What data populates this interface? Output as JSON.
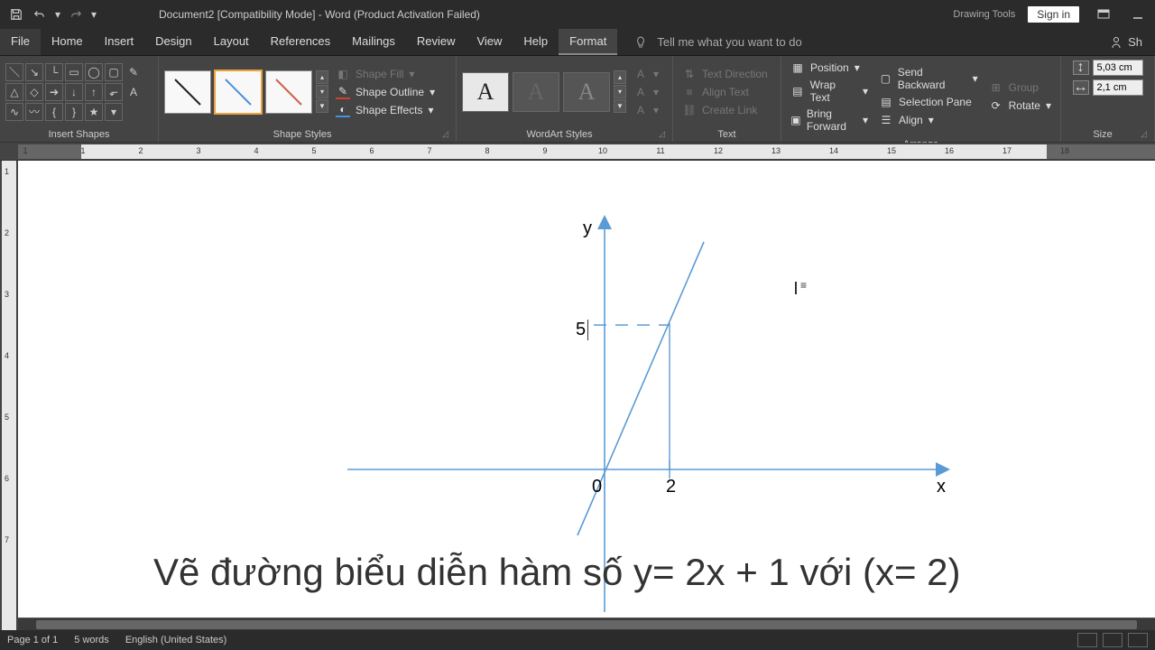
{
  "titlebar": {
    "document_title": "Document2 [Compatibility Mode] - Word (Product Activation Failed)",
    "context_tools": "Drawing Tools",
    "signin": "Sign in"
  },
  "menu": {
    "file": "File",
    "home": "Home",
    "insert": "Insert",
    "design": "Design",
    "layout": "Layout",
    "references": "References",
    "mailings": "Mailings",
    "review": "Review",
    "view": "View",
    "help": "Help",
    "format": "Format",
    "tellme": "Tell me what you want to do",
    "share": "Sh"
  },
  "ribbon": {
    "insert_shapes": "Insert Shapes",
    "shape_styles": "Shape Styles",
    "wordart_styles": "WordArt Styles",
    "text": "Text",
    "arrange": "Arrange",
    "size": "Size",
    "shape_fill": "Shape Fill",
    "shape_outline": "Shape Outline",
    "shape_effects": "Shape Effects",
    "text_direction": "Text Direction",
    "align_text": "Align Text",
    "create_link": "Create Link",
    "position": "Position",
    "wrap_text": "Wrap Text",
    "bring_forward": "Bring Forward",
    "send_backward": "Send Backward",
    "selection_pane": "Selection Pane",
    "align": "Align",
    "group": "Group",
    "rotate": "Rotate",
    "height": "5,03 cm",
    "width": "2,1 cm",
    "wa_sample": "A"
  },
  "ruler": {
    "h": [
      "1",
      "1",
      "2",
      "3",
      "4",
      "5",
      "6",
      "7",
      "8",
      "9",
      "10",
      "11",
      "12",
      "13",
      "14",
      "15",
      "16",
      "17",
      "18"
    ],
    "v": [
      "1",
      "2",
      "3",
      "4",
      "5",
      "6",
      "7"
    ]
  },
  "canvas": {
    "y_label": "y",
    "x_label": "x",
    "origin_label": "0",
    "x_tick": "2",
    "y_tick": "5",
    "caption": "Vẽ đường biểu diễn hàm số y= 2x + 1 với (x= 2)"
  },
  "status": {
    "page": "Page 1 of 1",
    "words": "5 words",
    "lang": "English (United States)"
  }
}
